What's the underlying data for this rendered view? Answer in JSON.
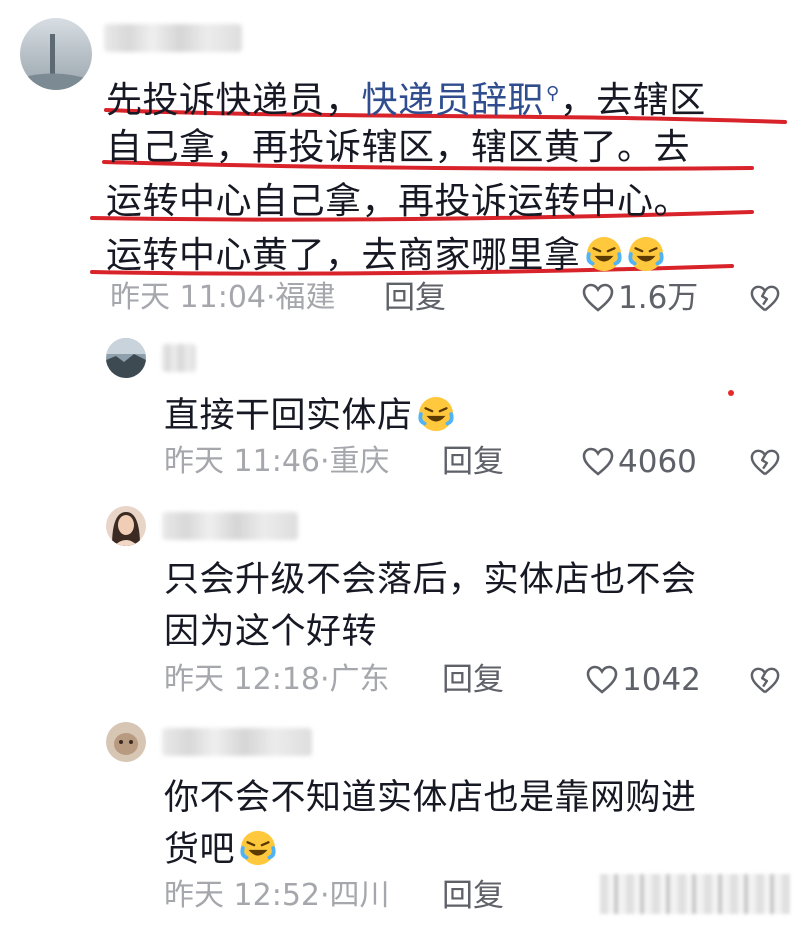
{
  "comments": [
    {
      "lines": [
        {
          "pre": "先投诉快递员，",
          "link": "快递员辞职",
          "post": "，去辖区"
        },
        "自己拿，再投诉辖区，辖区黄了。去",
        "运转中心自己拿，再投诉运转中心。",
        "运转中心黄了，去商家哪里拿"
      ],
      "time": "昨天 11:04",
      "location": "福建",
      "reply": "回复",
      "likes": "1.6万"
    },
    {
      "lines": [
        "直接干回实体店"
      ],
      "time": "昨天 11:46",
      "location": "重庆",
      "reply": "回复",
      "likes": "4060"
    },
    {
      "lines": [
        "只会升级不会落后，实体店也不会",
        "因为这个好转"
      ],
      "time": "昨天 12:18",
      "location": "广东",
      "reply": "回复",
      "likes": "1042"
    },
    {
      "lines": [
        "你不会不知道实体店也是靠网购进",
        "货吧"
      ],
      "time": "昨天 12:52",
      "location": "四川",
      "reply": "回复"
    }
  ],
  "icons": {
    "search": "search-icon",
    "emoji": "laughing-crying-emoji",
    "like": "heart-outline-icon",
    "dislike": "broken-heart-icon"
  },
  "colors": {
    "text": "#161823",
    "meta": "#a5a7ac",
    "link": "#2f4d8f",
    "underline": "#d8232a"
  },
  "separator": "·"
}
